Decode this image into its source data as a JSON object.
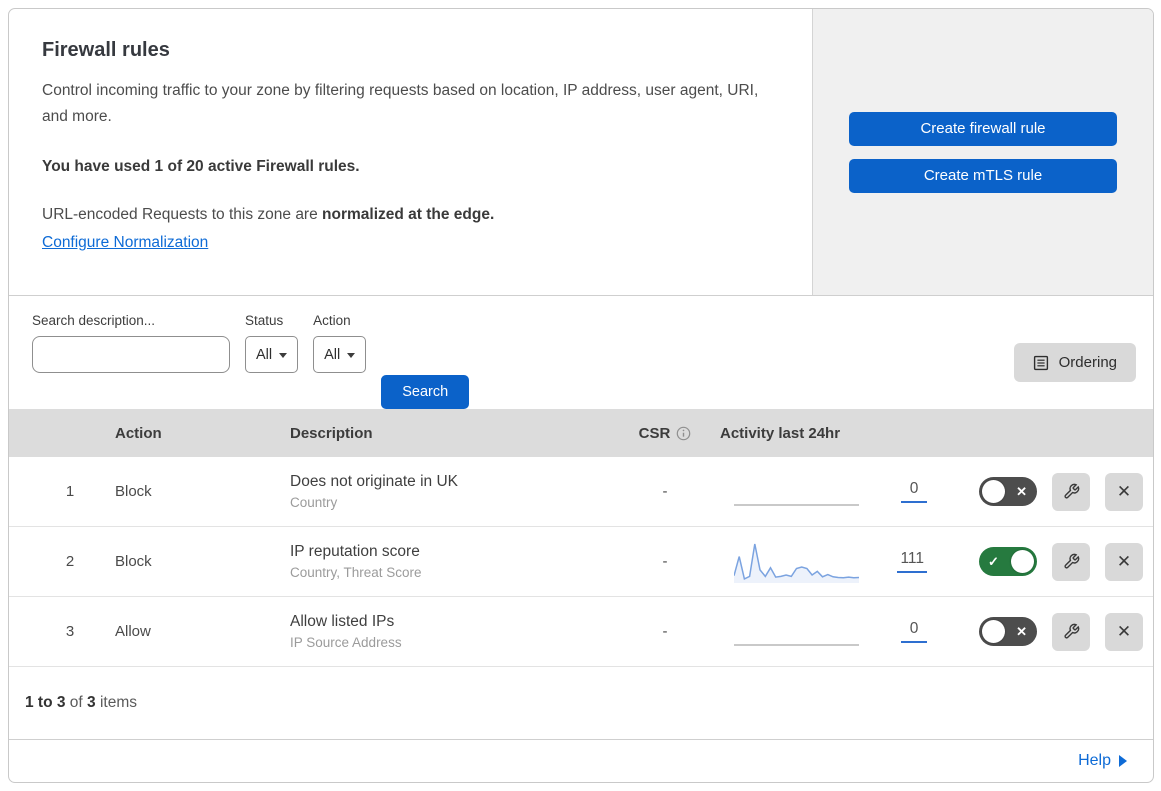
{
  "header": {
    "title": "Firewall rules",
    "description": "Control incoming traffic to your zone by filtering requests based on location, IP address, user agent, URI, and more.",
    "usage": "You have used 1 of 20 active Firewall rules.",
    "normalization_prefix": "URL-encoded Requests to this zone are ",
    "normalization_bold": "normalized at the edge.",
    "normalization_link": "Configure Normalization",
    "create_firewall_button": "Create firewall rule",
    "create_mtls_button": "Create mTLS rule"
  },
  "filters": {
    "search_label": "Search description...",
    "search_value": "",
    "status_label": "Status",
    "status_value": "All",
    "action_label": "Action",
    "action_value": "All",
    "search_button": "Search",
    "ordering_button": "Ordering"
  },
  "table": {
    "headers": {
      "action": "Action",
      "description": "Description",
      "csr": "CSR",
      "activity": "Activity last 24hr"
    },
    "rows": [
      {
        "num": "1",
        "action": "Block",
        "description": "Does not originate in UK",
        "fields": "Country",
        "csr": "-",
        "activity_count": "0",
        "enabled": false,
        "sparkline": null
      },
      {
        "num": "2",
        "action": "Block",
        "description": "IP reputation score",
        "fields": "Country, Threat Score",
        "csr": "-",
        "activity_count": "111",
        "enabled": true,
        "sparkline": [
          12,
          65,
          3,
          10,
          100,
          28,
          10,
          34,
          8,
          10,
          14,
          10,
          32,
          36,
          32,
          14,
          24,
          9,
          15,
          9,
          7,
          6,
          8,
          6,
          7
        ]
      },
      {
        "num": "3",
        "action": "Allow",
        "description": "Allow listed IPs",
        "fields": "IP Source Address",
        "csr": "-",
        "activity_count": "0",
        "enabled": false,
        "sparkline": null
      }
    ]
  },
  "footer": {
    "range": "1 to 3",
    "of": " of ",
    "total": "3",
    "items": " items",
    "help": "Help"
  },
  "icons": {
    "check": "✓",
    "cross": "✕",
    "close": "✕"
  },
  "colors": {
    "primary_blue": "#0b62c9",
    "link_blue": "#0e6bd6",
    "toggle_on_green": "#267a3f",
    "toggle_off_gray": "#4d4d4d",
    "sparkline": "#7ba3e0",
    "sparkline_fill": "#edf2fb",
    "table_header_bg": "#dcdcdc",
    "panel_bg": "#f0f0f0"
  }
}
